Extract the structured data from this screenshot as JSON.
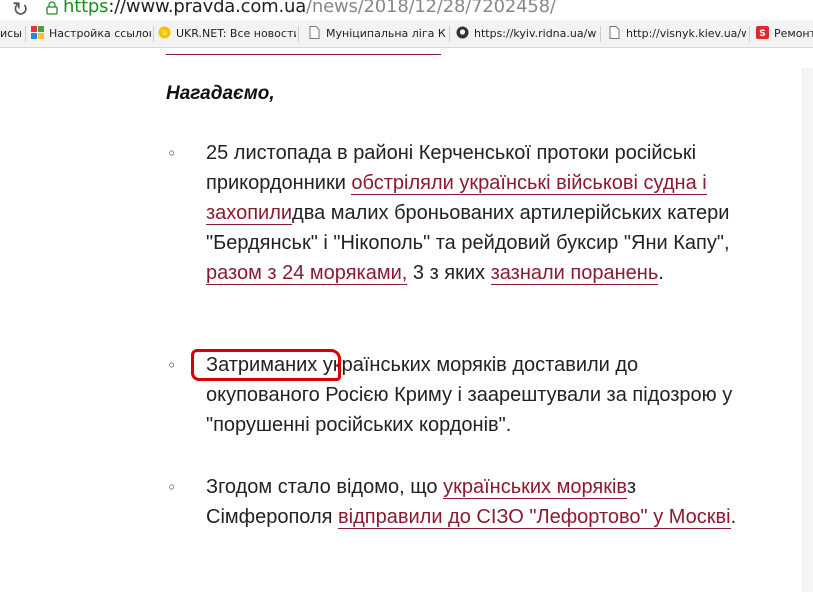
{
  "browser": {
    "url_scheme": "https",
    "url_host": "://www.pravda.com.ua",
    "url_path": "/news/2018/12/28/7202458/"
  },
  "bookmarks": [
    {
      "label": "исы",
      "icon": "truncated-bookmark"
    },
    {
      "label": "Настройка ссылок",
      "icon": "apps-grid-icon"
    },
    {
      "label": "UKR.NET: Все новости",
      "icon": "ukrnet-icon"
    },
    {
      "label": "Муніципальна ліга Киє",
      "icon": "page-icon"
    },
    {
      "label": "https://kyiv.ridna.ua/wp",
      "icon": "github-icon"
    },
    {
      "label": "http://visnyk.kiev.ua/wp",
      "icon": "page-icon"
    },
    {
      "label": "Ремонт",
      "icon": "s-red-icon"
    }
  ],
  "article": {
    "reminder": "Нагадаємо,",
    "items": [
      {
        "t1": "25 листопада в районі Керченської протоки російські прикордонники ",
        "l1": "обстріляли українські військові судна і захопили",
        "t2": "два малих броньованих артилерійських катери \"Бердянськ\" і \"Нікополь\" та рейдовий буксир \"Яни Капу\", ",
        "l2": "разом з 24 моряками,",
        "t3": " 3 з яких ",
        "l3": "зазнали поранень",
        "t4": "."
      },
      {
        "t1": "Затриманих",
        "t2": " українських моряків доставили до окупованого Росією Криму і заарештували за підозрою у \"порушенні російських кордонів\"."
      },
      {
        "t1": "Згодом стало відомо, що ",
        "l1": "українських моряків",
        "t2": "з Сімферополя ",
        "l2": "відправили до СІЗО \"Лефортово\" у Москві",
        "t3": "."
      }
    ],
    "bullet_symbol": "◦"
  },
  "colors": {
    "link": "#8b1a2f",
    "annotation": "#d60000"
  }
}
